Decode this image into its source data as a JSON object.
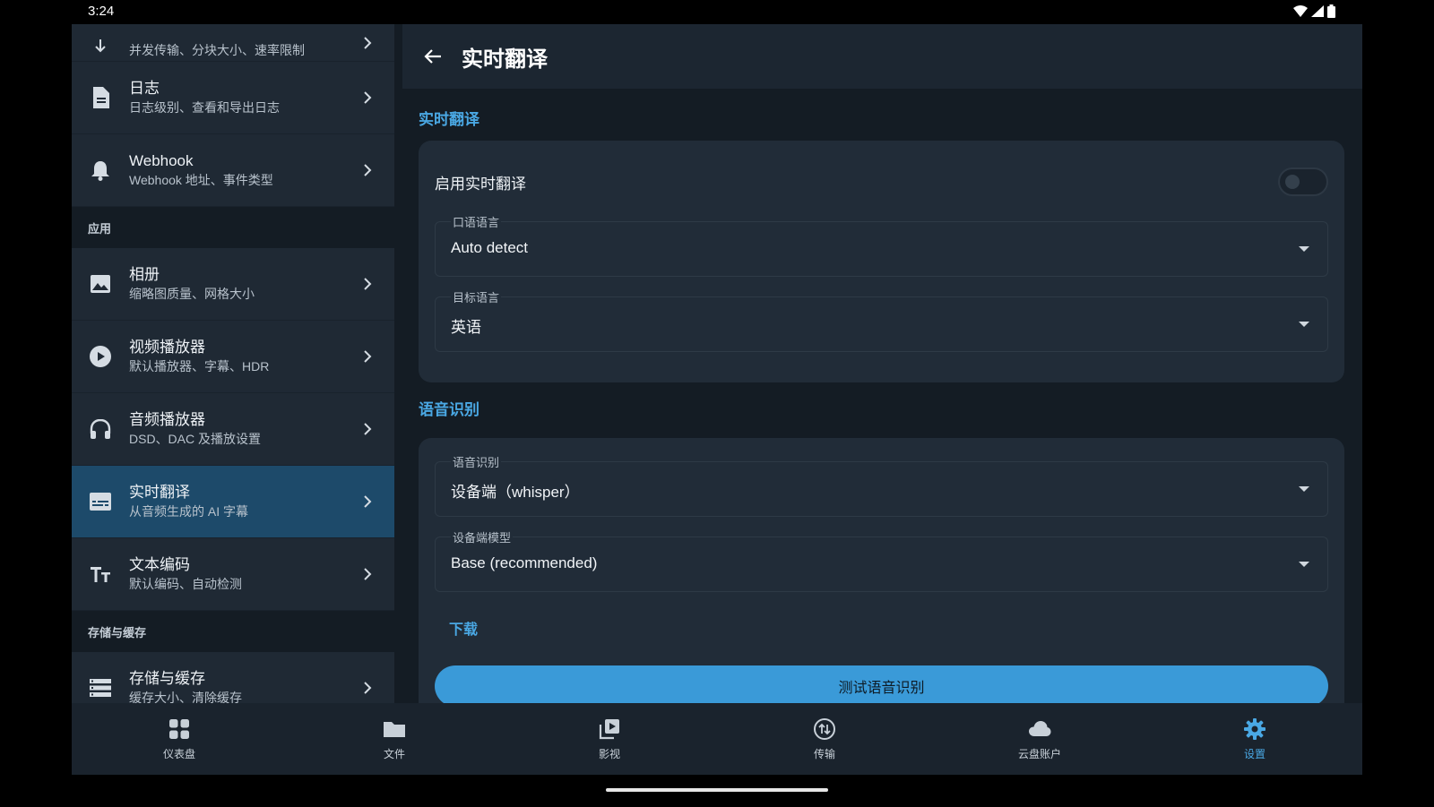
{
  "status_bar": {
    "time": "3:24"
  },
  "sidebar": {
    "groups": [
      {
        "items": [
          {
            "title": "",
            "subtitle": "并发传输、分块大小、速率限制",
            "icon": "transfer-icon"
          },
          {
            "title": "日志",
            "subtitle": "日志级别、查看和导出日志",
            "icon": "file-icon"
          },
          {
            "title": "Webhook",
            "subtitle": "Webhook 地址、事件类型",
            "icon": "bell-icon"
          }
        ]
      },
      {
        "header": "应用",
        "items": [
          {
            "title": "相册",
            "subtitle": "缩略图质量、网格大小",
            "icon": "image-icon"
          },
          {
            "title": "视频播放器",
            "subtitle": "默认播放器、字幕、HDR",
            "icon": "play-icon"
          },
          {
            "title": "音频播放器",
            "subtitle": "DSD、DAC 及播放设置",
            "icon": "headphones-icon"
          },
          {
            "title": "实时翻译",
            "subtitle": "从音频生成的 AI 字幕",
            "icon": "subtitles-icon",
            "selected": true
          },
          {
            "title": "文本编码",
            "subtitle": "默认编码、自动检测",
            "icon": "text-icon"
          }
        ]
      },
      {
        "header": "存储与缓存",
        "items": [
          {
            "title": "存储与缓存",
            "subtitle": "缓存大小、清除缓存",
            "icon": "storage-icon"
          }
        ]
      }
    ]
  },
  "detail": {
    "title": "实时翻译",
    "section_translate": "实时翻译",
    "enable_label": "启用实时翻译",
    "enable_on": false,
    "spoken_language": {
      "label": "口语语言",
      "value": "Auto detect"
    },
    "target_language": {
      "label": "目标语言",
      "value": "英语"
    },
    "section_asr": "语音识别",
    "asr_engine": {
      "label": "语音识别",
      "value": "设备端（whisper）"
    },
    "asr_model": {
      "label": "设备端模型",
      "value": "Base (recommended)"
    },
    "download_label": "下载",
    "test_button": "测试语音识别"
  },
  "bottom_nav": {
    "items": [
      {
        "label": "仪表盘",
        "icon": "dashboard-icon"
      },
      {
        "label": "文件",
        "icon": "folder-icon"
      },
      {
        "label": "影视",
        "icon": "media-icon"
      },
      {
        "label": "传输",
        "icon": "transfer-icon"
      },
      {
        "label": "云盘账户",
        "icon": "cloud-icon"
      },
      {
        "label": "设置",
        "icon": "gear-icon",
        "active": true
      }
    ]
  },
  "colors": {
    "accent": "#4aa8e4",
    "selected_bg": "#1d4a6a",
    "button": "#3a9ad8"
  }
}
